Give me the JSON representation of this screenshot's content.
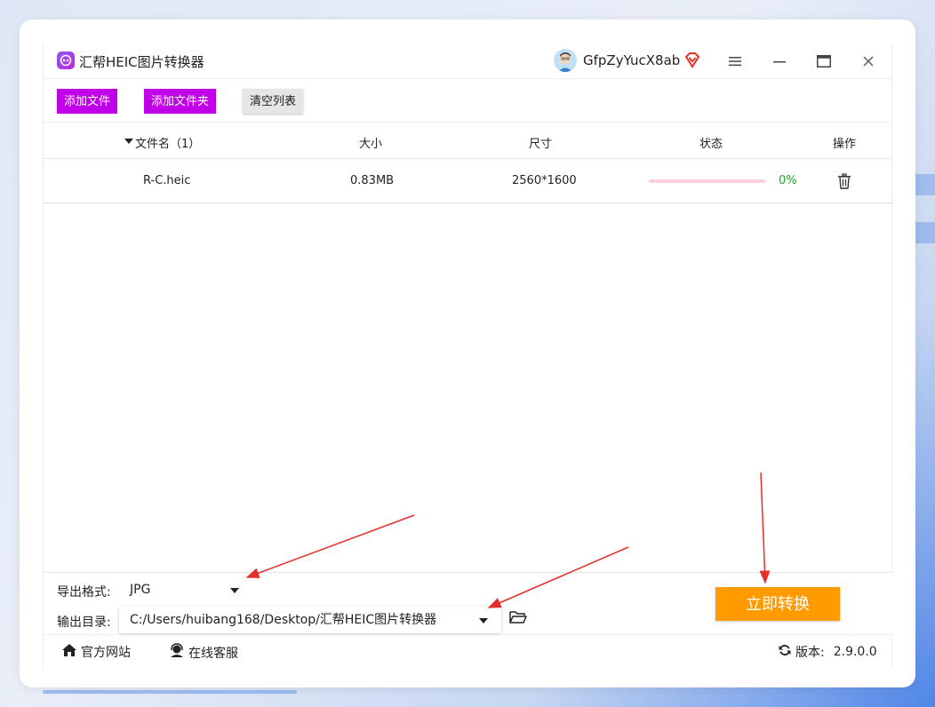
{
  "app": {
    "title": "汇帮HEIC图片转换器",
    "username": "GfpZyYucX8ab"
  },
  "toolbar": {
    "add_file": "添加文件",
    "add_folder": "添加文件夹",
    "clear_list": "清空列表"
  },
  "table": {
    "headers": {
      "filename": "文件名（1）",
      "size": "大小",
      "dimensions": "尺寸",
      "status": "状态",
      "actions": "操作"
    },
    "rows": [
      {
        "filename": "R-C.heic",
        "size": "0.83MB",
        "dimensions": "2560*1600",
        "progress_text": "0%",
        "progress_value": 0
      }
    ]
  },
  "settings": {
    "format_label": "导出格式:",
    "format_value": "JPG",
    "output_label": "输出目录:",
    "output_value": "C:/Users/huibang168/Desktop/汇帮HEIC图片转换器",
    "convert_label": "立即转换"
  },
  "footer": {
    "website": "官方网站",
    "support": "在线客服",
    "version_label": "版本:",
    "version_value": "2.9.0.0"
  },
  "colors": {
    "primary_purple": "#c000e6",
    "convert_orange": "#ff9a00",
    "progress_text": "#22a62c",
    "progress_track": "#f9d0dc",
    "annotation_arrow": "#e5302a"
  }
}
